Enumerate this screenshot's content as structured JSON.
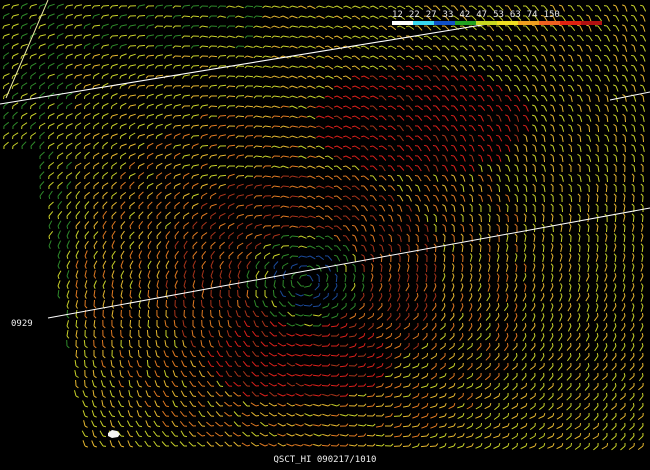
{
  "product_label": "QSCT_HI 090217/1010",
  "pass_time": "0929",
  "wind_scale": {
    "ticks": [
      "12",
      "22",
      "27",
      "33",
      "42",
      "47",
      "53",
      "63",
      "74",
      "150"
    ],
    "colors": [
      "#ffffff",
      "#38d8f0",
      "#1050c8",
      "#20a020",
      "#c8d820",
      "#f0e020",
      "#f0a020",
      "#f06020",
      "#e02010",
      "#b01010"
    ]
  },
  "wind_field_palette": {
    "weak": "#1b4a9a",
    "light": "#2f8a2a",
    "moderate": "#c9d22a",
    "fresh": "#e6b830",
    "strong": "#e07a22",
    "gale": "#a8341a",
    "storm": "#d9201a"
  }
}
